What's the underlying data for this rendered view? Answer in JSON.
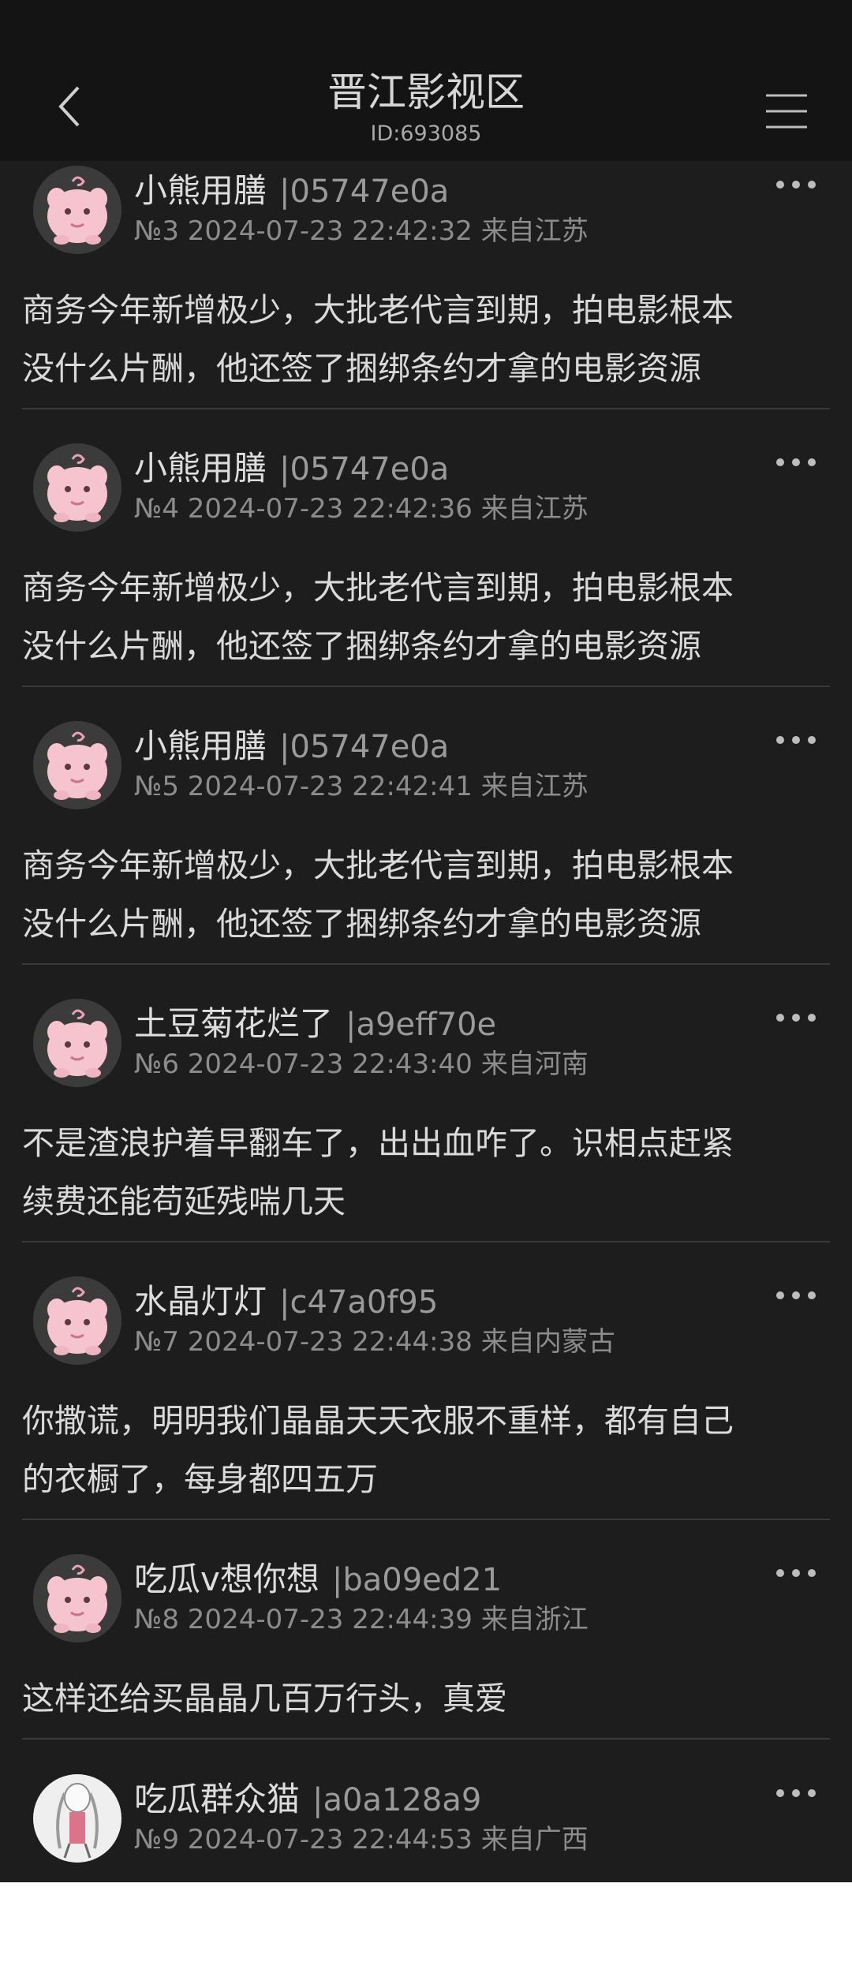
{
  "header": {
    "title": "晋江影视区",
    "sub_id": "ID:693085",
    "back_icon": "chevron-left-icon",
    "menu_icon": "hamburger-menu-icon"
  },
  "posts": [
    {
      "username": "小熊用膳",
      "uid": "|05747e0a",
      "meta": "№3 2024-07-23 22:42:32 来自江苏",
      "lines": [
        "商务今年新增极少，大批老代言到期，拍电影根本",
        "没什么片酬，他还签了捆绑条约才拿的电影资源"
      ],
      "avatar": "pink"
    },
    {
      "username": "小熊用膳",
      "uid": "|05747e0a",
      "meta": "№4 2024-07-23 22:42:36 来自江苏",
      "lines": [
        "商务今年新增极少，大批老代言到期，拍电影根本",
        "没什么片酬，他还签了捆绑条约才拿的电影资源"
      ],
      "avatar": "pink"
    },
    {
      "username": "小熊用膳",
      "uid": "|05747e0a",
      "meta": "№5 2024-07-23 22:42:41 来自江苏",
      "lines": [
        "商务今年新增极少，大批老代言到期，拍电影根本",
        "没什么片酬，他还签了捆绑条约才拿的电影资源"
      ],
      "avatar": "pink"
    },
    {
      "username": "土豆菊花烂了",
      "uid": "|a9eff70e",
      "meta": "№6 2024-07-23 22:43:40 来自河南",
      "lines": [
        "不是渣浪护着早翻车了，出出血咋了。识相点赶紧",
        "续费还能苟延残喘几天"
      ],
      "avatar": "pink"
    },
    {
      "username": "水晶灯灯",
      "uid": "|c47a0f95",
      "meta": "№7 2024-07-23 22:44:38 来自内蒙古",
      "lines": [
        "你撒谎，明明我们晶晶天天衣服不重样，都有自己",
        "的衣橱了，每身都四五万"
      ],
      "avatar": "pink"
    },
    {
      "username": "吃瓜v想你想",
      "uid": "|ba09ed21",
      "meta": "№8 2024-07-23 22:44:39 来自浙江",
      "lines": [
        "这样还给买晶晶几百万行头，真爱"
      ],
      "avatar": "pink"
    },
    {
      "username": "吃瓜群众猫",
      "uid": "|a0a128a9",
      "meta": "№9 2024-07-23 22:44:53 来自广西",
      "lines": [],
      "avatar": "white"
    }
  ],
  "colors": {
    "background": "#1d1d1d",
    "header": "#141414",
    "divider": "#3a3a3a"
  }
}
